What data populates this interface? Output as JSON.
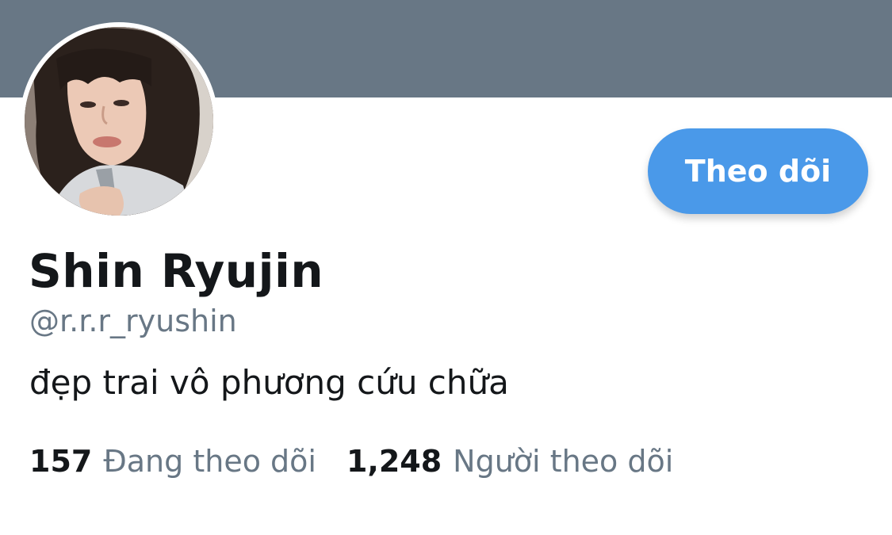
{
  "profile": {
    "display_name": "Shin Ryujin",
    "handle": "@r.r.r_ryushin",
    "bio": "đẹp trai vô phương cứu chữa",
    "follow_label": "Theo dõi",
    "stats": {
      "following_count": "157",
      "following_label": "Đang theo dõi",
      "followers_count": "1,248",
      "followers_label": "Người theo dõi"
    }
  },
  "colors": {
    "banner": "#687785",
    "accent": "#4a99e9",
    "text_primary": "#14171a",
    "text_secondary": "#687785"
  }
}
